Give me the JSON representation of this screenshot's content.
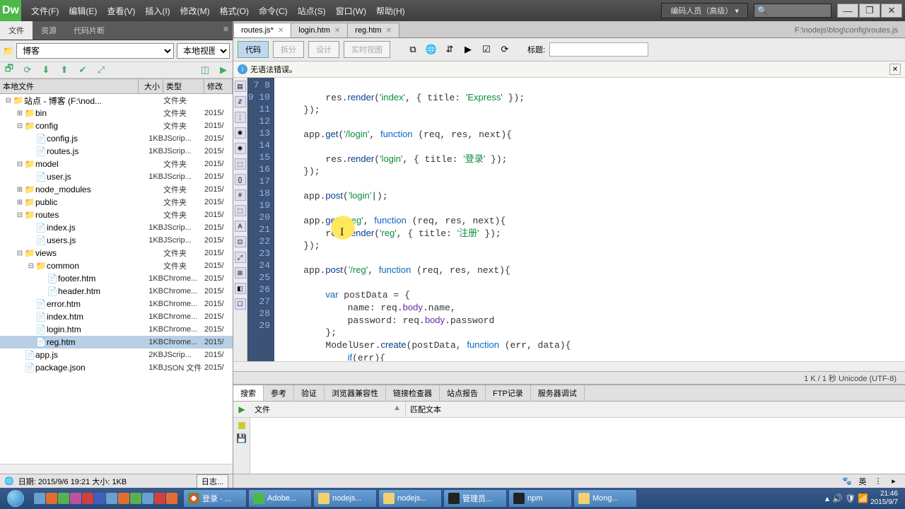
{
  "app": {
    "logo": "Dw"
  },
  "menus": [
    "文件(F)",
    "编辑(E)",
    "查看(V)",
    "插入(I)",
    "修改(M)",
    "格式(O)",
    "命令(C)",
    "站点(S)",
    "窗口(W)",
    "帮助(H)"
  ],
  "layout_selector": "编码人员（高级）",
  "search_icon": "🔍",
  "win_buttons": {
    "min": "—",
    "max": "❐",
    "close": "✕"
  },
  "side_panel": {
    "tabs": [
      "文件",
      "资源",
      "代码片断"
    ],
    "active_tab": 0,
    "site_selector": "博客",
    "view_selector": "本地视图",
    "toolbar_icons": {
      "i0": "🗗",
      "i1": "⟳",
      "i2": "⬇",
      "i3": "⬆",
      "i4": "✔",
      "i5": "⤢",
      "i6": "◫",
      "i7": "▶"
    },
    "tree_headers": [
      "本地文件",
      "大小",
      "类型",
      "修改"
    ],
    "tree": [
      {
        "d": 0,
        "t": "-",
        "if": true,
        "name": "站点 - 博客 (F:\\nod...",
        "size": "",
        "type": "文件夹",
        "mod": ""
      },
      {
        "d": 1,
        "t": "+",
        "if": true,
        "name": "bin",
        "size": "",
        "type": "文件夹",
        "mod": "2015/"
      },
      {
        "d": 1,
        "t": "-",
        "if": true,
        "name": "config",
        "size": "",
        "type": "文件夹",
        "mod": "2015/"
      },
      {
        "d": 2,
        "t": "",
        "if": false,
        "name": "config.js",
        "size": "1KB",
        "type": "JScrip...",
        "mod": "2015/"
      },
      {
        "d": 2,
        "t": "",
        "if": false,
        "name": "routes.js",
        "size": "1KB",
        "type": "JScrip...",
        "mod": "2015/"
      },
      {
        "d": 1,
        "t": "-",
        "if": true,
        "name": "model",
        "size": "",
        "type": "文件夹",
        "mod": "2015/"
      },
      {
        "d": 2,
        "t": "",
        "if": false,
        "name": "user.js",
        "size": "1KB",
        "type": "JScrip...",
        "mod": "2015/"
      },
      {
        "d": 1,
        "t": "+",
        "if": true,
        "name": "node_modules",
        "size": "",
        "type": "文件夹",
        "mod": "2015/"
      },
      {
        "d": 1,
        "t": "+",
        "if": true,
        "name": "public",
        "size": "",
        "type": "文件夹",
        "mod": "2015/"
      },
      {
        "d": 1,
        "t": "-",
        "if": true,
        "name": "routes",
        "size": "",
        "type": "文件夹",
        "mod": "2015/"
      },
      {
        "d": 2,
        "t": "",
        "if": false,
        "name": "index.js",
        "size": "1KB",
        "type": "JScrip...",
        "mod": "2015/"
      },
      {
        "d": 2,
        "t": "",
        "if": false,
        "name": "users.js",
        "size": "1KB",
        "type": "JScrip...",
        "mod": "2015/"
      },
      {
        "d": 1,
        "t": "-",
        "if": true,
        "name": "views",
        "size": "",
        "type": "文件夹",
        "mod": "2015/"
      },
      {
        "d": 2,
        "t": "-",
        "if": true,
        "name": "common",
        "size": "",
        "type": "文件夹",
        "mod": "2015/"
      },
      {
        "d": 3,
        "t": "",
        "if": false,
        "name": "footer.htm",
        "size": "1KB",
        "type": "Chrome...",
        "mod": "2015/"
      },
      {
        "d": 3,
        "t": "",
        "if": false,
        "name": "header.htm",
        "size": "1KB",
        "type": "Chrome...",
        "mod": "2015/"
      },
      {
        "d": 2,
        "t": "",
        "if": false,
        "name": "error.htm",
        "size": "1KB",
        "type": "Chrome...",
        "mod": "2015/"
      },
      {
        "d": 2,
        "t": "",
        "if": false,
        "name": "index.htm",
        "size": "1KB",
        "type": "Chrome...",
        "mod": "2015/"
      },
      {
        "d": 2,
        "t": "",
        "if": false,
        "name": "login.htm",
        "size": "1KB",
        "type": "Chrome...",
        "mod": "2015/"
      },
      {
        "d": 2,
        "t": "",
        "if": false,
        "name": "reg.htm",
        "size": "1KB",
        "type": "Chrome...",
        "mod": "2015/",
        "sel": true
      },
      {
        "d": 1,
        "t": "",
        "if": false,
        "name": "app.js",
        "size": "2KB",
        "type": "JScrip...",
        "mod": "2015/"
      },
      {
        "d": 1,
        "t": "",
        "if": false,
        "name": "package.json",
        "size": "1KB",
        "type": "JSON 文件",
        "mod": "2015/"
      }
    ],
    "status_prefix": "🌐",
    "status": "日期: 2015/9/6 19:21 大小: 1KB",
    "log_btn": "日志..."
  },
  "doc_tabs": [
    {
      "label": "routes.js*",
      "active": true
    },
    {
      "label": "login.htm",
      "active": false
    },
    {
      "label": "reg.htm",
      "active": false
    }
  ],
  "doc_path": "F:\\nodejs\\blog\\config\\routes.js",
  "view_buttons": {
    "code": "代码",
    "split": "拆分",
    "design": "设计",
    "live": "实时视图"
  },
  "vr_label_title": "标题:",
  "syntax_msg": "无语法错误。",
  "gutter_start": 7,
  "gutter_end": 29,
  "code_status": "1 K / 1 秒 Unicode (UTF-8)",
  "bottom_panel": {
    "tabs": [
      "搜索",
      "参考",
      "验证",
      "浏览器兼容性",
      "链接检查器",
      "站点报告",
      "FTP记录",
      "服务器调试"
    ],
    "active": 0,
    "col1": "文件",
    "col_arrow": "▲",
    "col2": "匹配文本"
  },
  "tray": {
    "paw": "🐾",
    "lang": "英",
    "sep": "⋮"
  },
  "taskbar": {
    "items": [
      {
        "ic": "chrome",
        "label": "登录 - ..."
      },
      {
        "ic": "dw",
        "label": "Adobe..."
      },
      {
        "ic": "fold",
        "label": "nodejs..."
      },
      {
        "ic": "fold",
        "label": "nodejs..."
      },
      {
        "ic": "cmd",
        "label": "管理员..."
      },
      {
        "ic": "cmd",
        "label": "npm"
      },
      {
        "ic": "fold",
        "label": "Mong..."
      }
    ],
    "time": "21:46",
    "date": "2015/9/7"
  }
}
